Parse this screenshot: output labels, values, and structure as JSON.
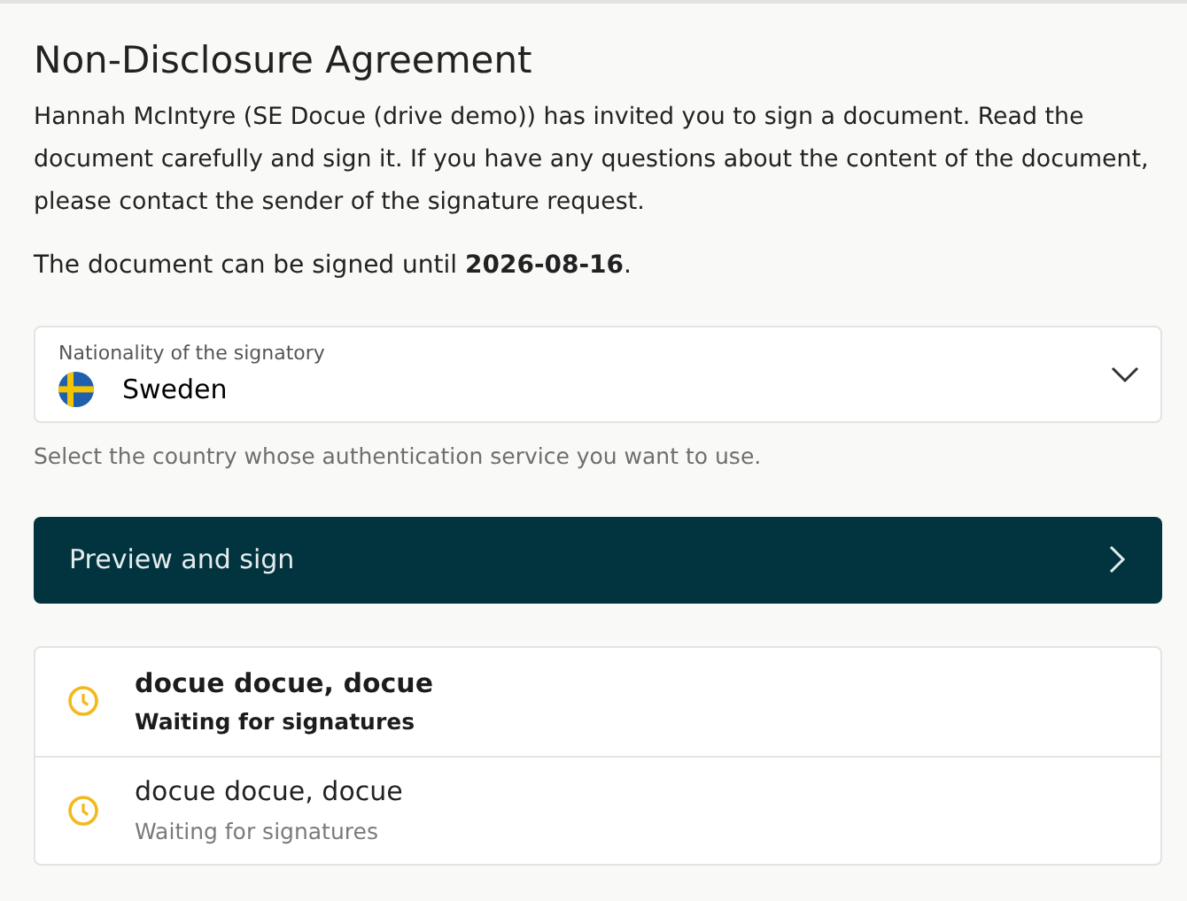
{
  "title": "Non-Disclosure Agreement",
  "intro": "Hannah McIntyre (SE Docue (drive demo)) has invited you to sign a document. Read the document carefully and sign it. If you have any questions about the content of the document, please contact the sender of the signature request.",
  "deadline": "The document can be signed until **2026-08-16**.",
  "nationality": {
    "label": "Nationality of the signatory",
    "value": "Sweden",
    "help": "Select the country whose authentication service you want to use."
  },
  "action_button": {
    "label": "Preview and sign"
  },
  "signers": [
    {
      "name": "docue docue, docue",
      "status": "Waiting for signatures",
      "selected": true
    },
    {
      "name": "docue docue, docue",
      "status": "Waiting for signatures",
      "selected": false
    }
  ]
}
